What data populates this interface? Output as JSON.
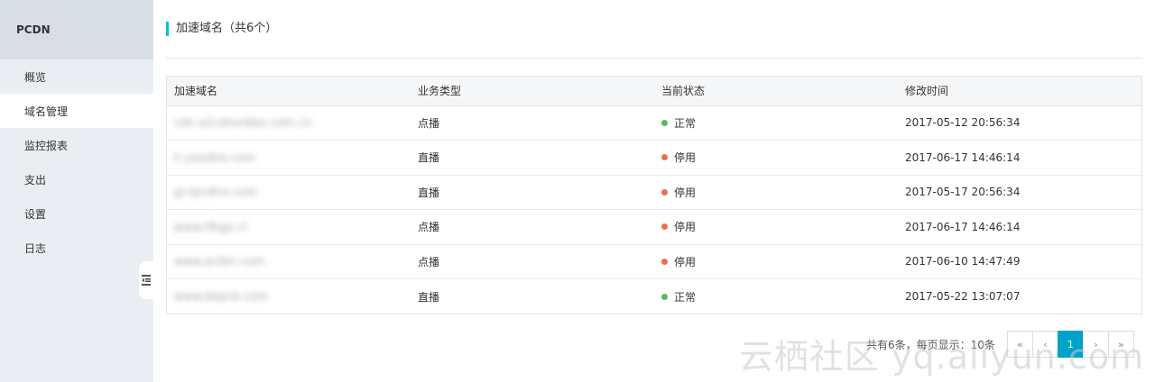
{
  "sidebar": {
    "title": "PCDN",
    "items": [
      {
        "label": "概览"
      },
      {
        "label": "域名管理"
      },
      {
        "label": "监控报表"
      },
      {
        "label": "支出"
      },
      {
        "label": "设置"
      },
      {
        "label": "日志"
      }
    ],
    "collapse_icon": "collapse-sidebar-icon"
  },
  "main": {
    "title": "加速域名（共6个）",
    "table": {
      "headers": [
        "加速域名",
        "业务类型",
        "当前状态",
        "修改时间"
      ],
      "rows": [
        {
          "domain": "cdn.a1cdnvideo.com.cn",
          "type": "点播",
          "status": "正常",
          "status_color": "#5cb85c",
          "time": "2017-05-12 20:56:34"
        },
        {
          "domain": "li.yoodno.com",
          "type": "直播",
          "status": "停用",
          "status_color": "#e8734a",
          "time": "2017-06-17 14:46:14"
        },
        {
          "domain": "gl.tpcdno.com",
          "type": "直播",
          "status": "停用",
          "status_color": "#e8734a",
          "time": "2017-05-17 20:56:34"
        },
        {
          "domain": "www.lfkgo.cl",
          "type": "点播",
          "status": "停用",
          "status_color": "#e8734a",
          "time": "2017-06-17 14:46:14"
        },
        {
          "domain": "www.aclbn.com",
          "type": "点播",
          "status": "停用",
          "status_color": "#e8734a",
          "time": "2017-06-10 14:47:49"
        },
        {
          "domain": "www.bkpcb.com",
          "type": "直播",
          "status": "正常",
          "status_color": "#5cb85c",
          "time": "2017-05-22 13:07:07"
        }
      ]
    }
  },
  "pagination": {
    "summary": "共有6条，每页显示：10条",
    "first": "«",
    "prev": "‹",
    "current": "1",
    "next": "›",
    "last": "»"
  },
  "watermark": "云栖社区 yq.aliyun.com"
}
